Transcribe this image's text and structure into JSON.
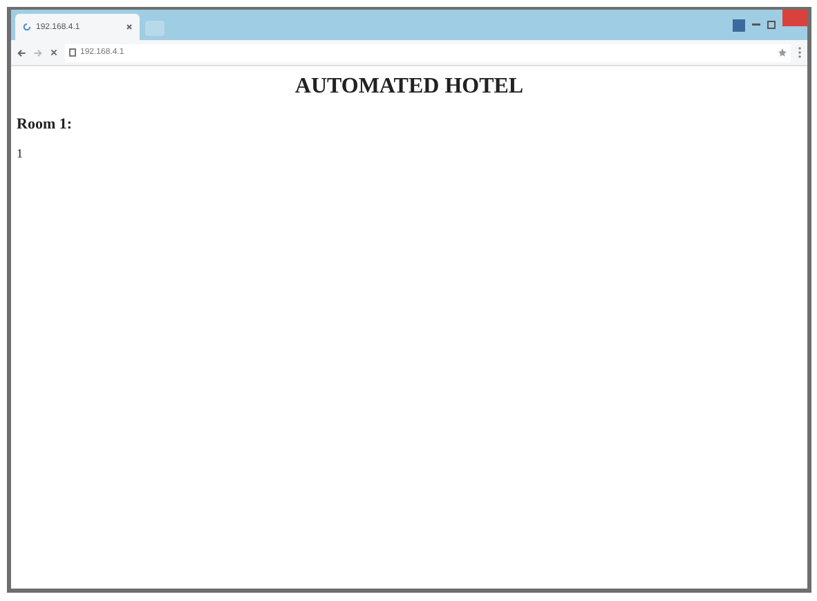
{
  "browser": {
    "tab": {
      "title": "192.168.4.1",
      "selected": true
    },
    "address": "192.168.4.1"
  },
  "page": {
    "heading": "AUTOMATED HOTEL",
    "room_label": "Room 1:",
    "room_value": "1"
  }
}
